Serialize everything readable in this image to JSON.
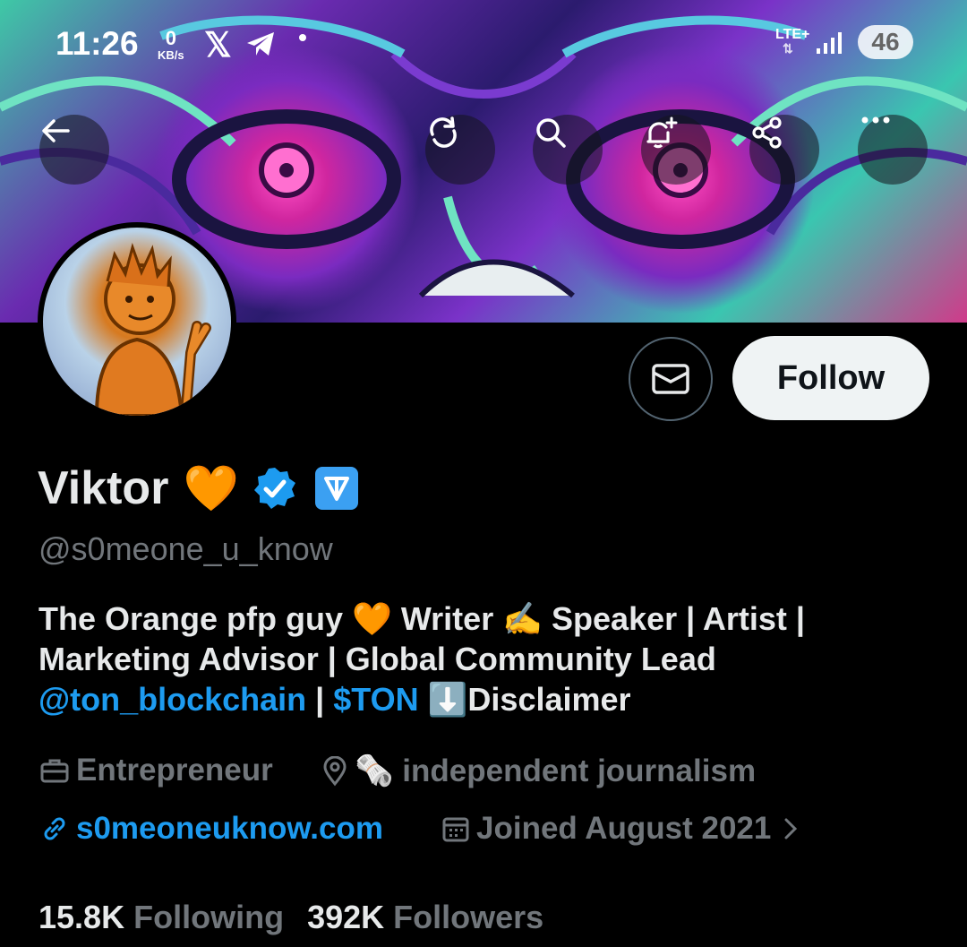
{
  "status_bar": {
    "time": "11:26",
    "net_speed_value": "0",
    "net_speed_unit": "KB/s",
    "network": "LTE+",
    "battery": "46"
  },
  "header_actions": [
    "back",
    "refresh",
    "search",
    "notify-add",
    "share",
    "more"
  ],
  "profile": {
    "name": "Viktor",
    "handle": "@s0meone_u_know",
    "bio_plain_1": "The Orange pfp guy 🧡 Writer ✍️ Speaker | Artist |",
    "bio_plain_2": "Marketing Advisor | Global Community Lead",
    "bio_link_1": "@ton_blockchain",
    "bio_sep": " | ",
    "bio_link_2": "$TON",
    "bio_tail": " ⬇️Disclaimer",
    "profession": "Entrepreneur",
    "location": "🗞️ independent journalism",
    "website": "s0meoneuknow.com",
    "joined": "Joined August 2021",
    "following_count": "15.8K",
    "following_label": "Following",
    "followers_count": "392K",
    "followers_label": "Followers"
  },
  "actions": {
    "follow_label": "Follow"
  },
  "colors": {
    "background": "#000000",
    "link": "#1d9bf0",
    "secondary_text": "#71767b",
    "verified": "#1d9bf0",
    "ton_badge": "#3ba0f2"
  }
}
